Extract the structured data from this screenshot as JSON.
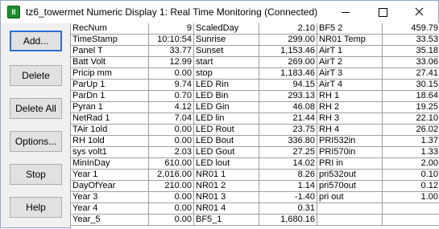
{
  "window": {
    "title": "tz6_towermet Numeric Display 1: Real Time Monitoring (Connected)",
    "icon": "green-tower-icon"
  },
  "buttons": [
    {
      "label": "Add...",
      "name": "add-button"
    },
    {
      "label": "Delete",
      "name": "delete-button"
    },
    {
      "label": "Delete All",
      "name": "delete-all-button"
    },
    {
      "label": "Options...",
      "name": "options-button"
    },
    {
      "label": "Stop",
      "name": "stop-button"
    },
    {
      "label": "Help",
      "name": "help-button"
    }
  ],
  "table": {
    "columns": [
      [
        [
          "RecNum",
          "9"
        ],
        [
          "TimeStamp",
          "10:10:54"
        ],
        [
          "Panel  T",
          "33.77"
        ],
        [
          "Batt  Volt",
          "12.99"
        ],
        [
          "Pricip  mm",
          "0.00"
        ],
        [
          "ParUp  1",
          "9.74"
        ],
        [
          "ParDn  1",
          "0.70"
        ],
        [
          "Pyran  1",
          "4.12"
        ],
        [
          "NetRad  1",
          "7.04"
        ],
        [
          "TAir  1old",
          "0.00"
        ],
        [
          "RH  1old",
          "0.00"
        ],
        [
          "sys  volt1",
          "2.03"
        ],
        [
          "MinInDay",
          "610.00"
        ],
        [
          "Year  1",
          "2,016.00"
        ],
        [
          "DayOfYear",
          "210.00"
        ],
        [
          "Year  3",
          "0.00"
        ],
        [
          "Year  4",
          "0.00"
        ],
        [
          "Year_5",
          "0.00"
        ]
      ],
      [
        [
          "ScaledDay",
          "2.10"
        ],
        [
          "Sunrise",
          "299.00"
        ],
        [
          "Sunset",
          "1,153.46"
        ],
        [
          "start",
          "269.00"
        ],
        [
          "stop",
          "1,183.46"
        ],
        [
          "LED  Rin",
          "94.15"
        ],
        [
          "LED  Bin",
          "293.13"
        ],
        [
          "LED  Gin",
          "46.08"
        ],
        [
          "LED  lin",
          "21.44"
        ],
        [
          "LED  Rout",
          "23.75"
        ],
        [
          "LED  Bout",
          "336.80"
        ],
        [
          "LED  Gout",
          "27.25"
        ],
        [
          "LED  lout",
          "14.02"
        ],
        [
          "NR01  1",
          "8.26"
        ],
        [
          "NR01  2",
          "1.14"
        ],
        [
          "NR01  3",
          "-1.40"
        ],
        [
          "NR01  4",
          "0.31"
        ],
        [
          "BF5_1",
          "1,680.16"
        ]
      ],
      [
        [
          "BF5  2",
          "459.79"
        ],
        [
          "NR01  Temp",
          "33.53"
        ],
        [
          "AirT  1",
          "35.18"
        ],
        [
          "AirT  2",
          "33.06"
        ],
        [
          "AirT  3",
          "27.41"
        ],
        [
          "AirT  4",
          "30.15"
        ],
        [
          "RH  1",
          "18.64"
        ],
        [
          "RH  2",
          "19.25"
        ],
        [
          "RH  3",
          "22.10"
        ],
        [
          "RH  4",
          "26.02"
        ],
        [
          "PRI532in",
          "1.37"
        ],
        [
          "PRI570in",
          "1.33"
        ],
        [
          "PRI  in",
          "2.00"
        ],
        [
          "pri532out",
          "0.10"
        ],
        [
          "pri570out",
          "0.12"
        ],
        [
          "pri  out",
          "1.00"
        ],
        [
          "",
          ""
        ],
        [
          "",
          ""
        ]
      ]
    ]
  }
}
